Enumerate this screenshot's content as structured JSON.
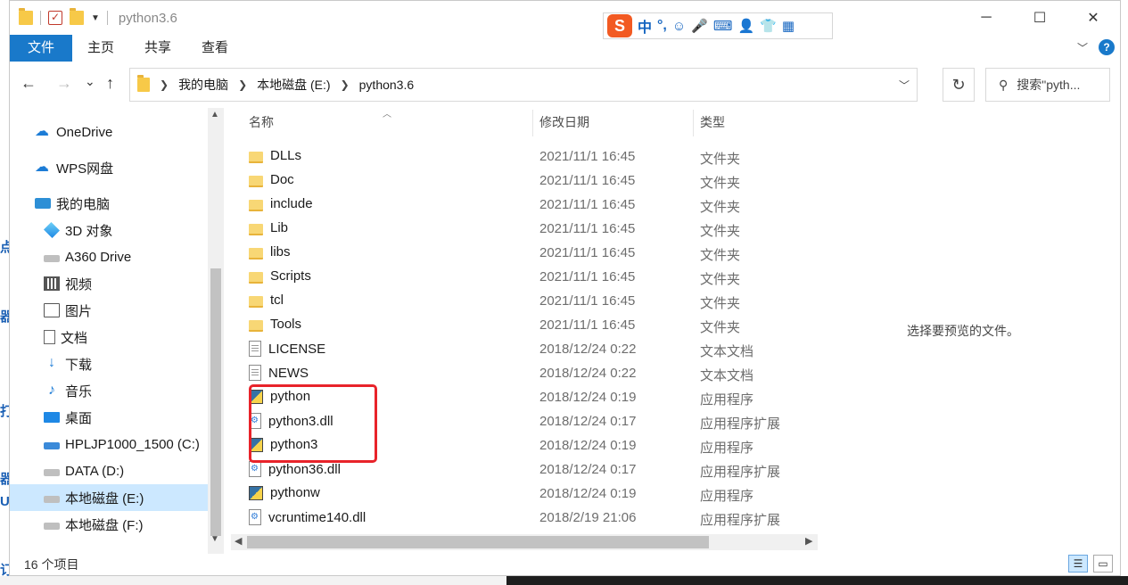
{
  "window": {
    "title": "python3.6",
    "controls": {
      "minimize": "─",
      "maximize": "☐",
      "close": "✕"
    }
  },
  "ime": {
    "logo": "S",
    "items": [
      "中",
      "°,"
    ],
    "tools": [
      "☺",
      "🎤",
      "⌨",
      "👤",
      "👕",
      "▦"
    ]
  },
  "ribbon": {
    "tabs": [
      "文件",
      "主页",
      "共享",
      "查看"
    ],
    "expand_icon": "chevron-down-icon",
    "help_label": "?"
  },
  "nav": {
    "back": "←",
    "forward": "→",
    "recent": "⌄",
    "up": "↑"
  },
  "address": {
    "crumbs": [
      "我的电脑",
      "本地磁盘 (E:)",
      "python3.6"
    ]
  },
  "search": {
    "placeholder": "搜索\"pyth..."
  },
  "sidebar": {
    "items": [
      {
        "label": "OneDrive",
        "icon": "cloud-icon"
      },
      {
        "label": "WPS网盘",
        "icon": "cloud-icon"
      },
      {
        "label": "我的电脑",
        "icon": "computer-icon"
      },
      {
        "label": "3D 对象",
        "icon": "cube-icon"
      },
      {
        "label": "A360 Drive",
        "icon": "drive-icon"
      },
      {
        "label": "视频",
        "icon": "film-icon"
      },
      {
        "label": "图片",
        "icon": "image-icon"
      },
      {
        "label": "文档",
        "icon": "document-icon"
      },
      {
        "label": "下载",
        "icon": "download-icon"
      },
      {
        "label": "音乐",
        "icon": "music-icon"
      },
      {
        "label": "桌面",
        "icon": "desktop-icon"
      },
      {
        "label": "HPLJP1000_1500 (C:)",
        "icon": "drive-icon"
      },
      {
        "label": "DATA (D:)",
        "icon": "drive-icon"
      },
      {
        "label": "本地磁盘 (E:)",
        "icon": "drive-icon",
        "selected": true
      },
      {
        "label": "本地磁盘 (F:)",
        "icon": "drive-icon"
      }
    ]
  },
  "files": {
    "columns": [
      "名称",
      "修改日期",
      "类型"
    ],
    "rows": [
      {
        "name": "DLLs",
        "date": "2021/11/1 16:45",
        "type": "文件夹",
        "icon": "folder"
      },
      {
        "name": "Doc",
        "date": "2021/11/1 16:45",
        "type": "文件夹",
        "icon": "folder"
      },
      {
        "name": "include",
        "date": "2021/11/1 16:45",
        "type": "文件夹",
        "icon": "folder"
      },
      {
        "name": "Lib",
        "date": "2021/11/1 16:45",
        "type": "文件夹",
        "icon": "folder"
      },
      {
        "name": "libs",
        "date": "2021/11/1 16:45",
        "type": "文件夹",
        "icon": "folder"
      },
      {
        "name": "Scripts",
        "date": "2021/11/1 16:45",
        "type": "文件夹",
        "icon": "folder"
      },
      {
        "name": "tcl",
        "date": "2021/11/1 16:45",
        "type": "文件夹",
        "icon": "folder"
      },
      {
        "name": "Tools",
        "date": "2021/11/1 16:45",
        "type": "文件夹",
        "icon": "folder"
      },
      {
        "name": "LICENSE",
        "date": "2018/12/24 0:22",
        "type": "文本文档",
        "icon": "text"
      },
      {
        "name": "NEWS",
        "date": "2018/12/24 0:22",
        "type": "文本文档",
        "icon": "text"
      },
      {
        "name": "python",
        "date": "2018/12/24 0:19",
        "type": "应用程序",
        "icon": "exe"
      },
      {
        "name": "python3.dll",
        "date": "2018/12/24 0:17",
        "type": "应用程序扩展",
        "icon": "dll"
      },
      {
        "name": "python3",
        "date": "2018/12/24 0:19",
        "type": "应用程序",
        "icon": "exe"
      },
      {
        "name": "python36.dll",
        "date": "2018/12/24 0:17",
        "type": "应用程序扩展",
        "icon": "dll"
      },
      {
        "name": "pythonw",
        "date": "2018/12/24 0:19",
        "type": "应用程序",
        "icon": "exe"
      },
      {
        "name": "vcruntime140.dll",
        "date": "2018/2/19 21:06",
        "type": "应用程序扩展",
        "icon": "dll"
      }
    ]
  },
  "preview": {
    "text": "选择要预览的文件。"
  },
  "status": {
    "count_text": "16 个项目"
  },
  "background_page": {
    "chars": [
      "点",
      "器",
      "打",
      "器",
      "Ur",
      "订"
    ]
  }
}
